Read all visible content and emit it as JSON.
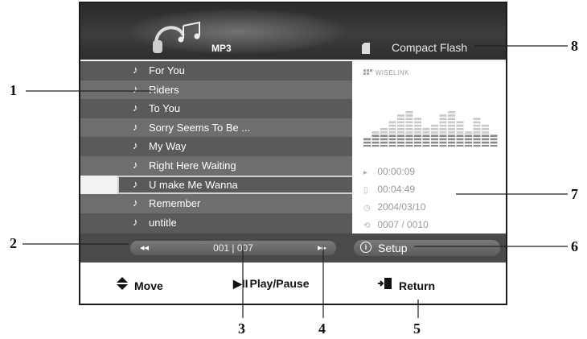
{
  "header": {
    "mode_label": "MP3",
    "storage_label": "Compact Flash",
    "icons": {
      "logo": "headphones-music-icon",
      "storage": "memory-card-icon"
    }
  },
  "playlist": {
    "items": [
      {
        "title": "For You"
      },
      {
        "title": "Riders"
      },
      {
        "title": "To You"
      },
      {
        "title": "Sorry Seems To Be ..."
      },
      {
        "title": "My Way"
      },
      {
        "title": "Right Here Waiting"
      },
      {
        "title": "U make Me Wanna",
        "selected": true
      },
      {
        "title": "Remember"
      },
      {
        "title": "untitle"
      }
    ],
    "item_icon": "music-note-icon"
  },
  "info_panel": {
    "brand": "WISELINK",
    "elapsed": "00:00:09",
    "duration": "00:04:49",
    "date": "2004/03/10",
    "track_index": "0007 / 0010"
  },
  "pager": {
    "prev_symbol": "◂◂",
    "next_symbol": "▸▸",
    "count": "001 | 007"
  },
  "setup": {
    "label": "Setup",
    "icon": "info-icon"
  },
  "footer": {
    "move_label": "Move",
    "play_label": "Play/Pause",
    "return_label": "Return",
    "icons": {
      "move": "up-down-arrow-icon",
      "play": "play-pause-icon",
      "return": "return-icon"
    }
  },
  "callouts": {
    "c1": "1",
    "c2": "2",
    "c3": "3",
    "c4": "4",
    "c5": "5",
    "c6": "6",
    "c7": "7",
    "c8": "8"
  },
  "colors": {
    "header_bg": "#333333",
    "row_dark": "#5a5a5a",
    "row_light": "#6e6e6e",
    "panel_bg": "#ffffff"
  }
}
